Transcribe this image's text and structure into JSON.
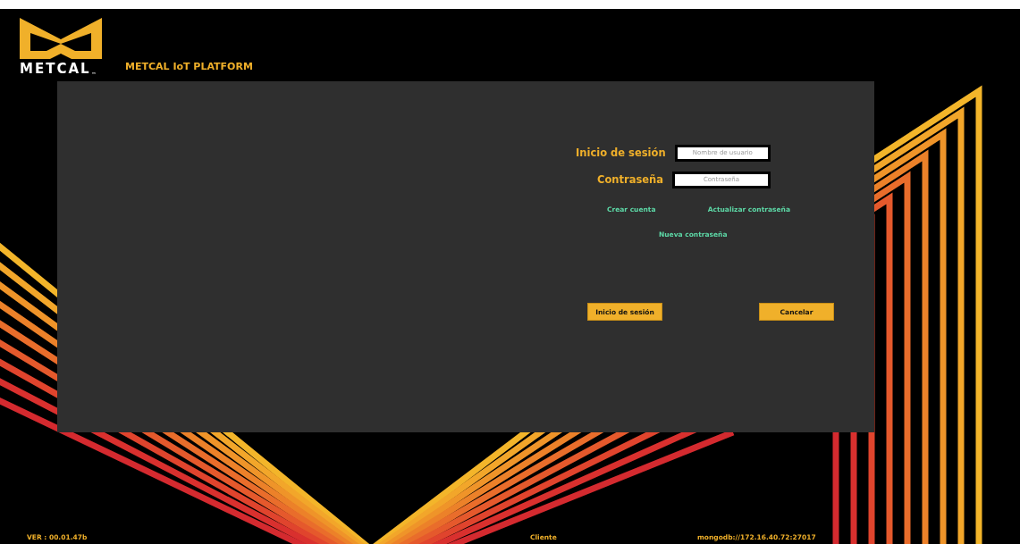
{
  "header": {
    "logo_text": "METCAL",
    "trademark": "™",
    "title": "METCAL IoT PLATFORM"
  },
  "login": {
    "fields": [
      {
        "label": "Inicio de sesión",
        "placeholder": "Nombre de usuario"
      },
      {
        "label": "Contraseña",
        "placeholder": "Contraseña"
      }
    ],
    "links": [
      "Crear cuenta",
      "Actualizar contraseña",
      "Nueva contraseña"
    ],
    "buttons": [
      "Inicio de sesión",
      "Cancelar"
    ]
  },
  "footer": {
    "version": "VER : 00.01.47b",
    "client": "Cliente",
    "database": "mongodb://172.16.40.72:27017"
  }
}
